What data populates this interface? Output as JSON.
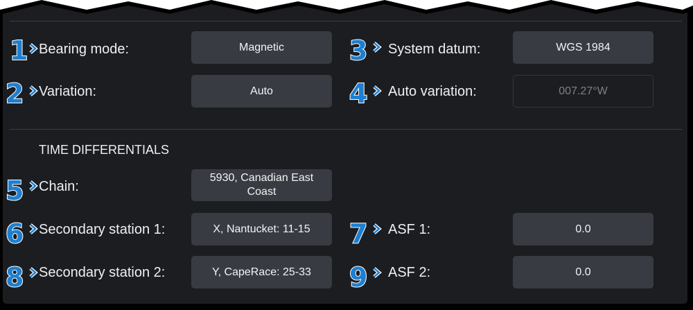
{
  "colors": {
    "panel_bg": "#1c1d20",
    "control_bg": "#383b41",
    "number_blue": "#1e7fd0",
    "text": "#eef0f2",
    "disabled_text": "#7d8186"
  },
  "rows": [
    {
      "marker": "1",
      "label": "Bearing mode:",
      "value": "Magnetic"
    },
    {
      "marker": "2",
      "label": "Variation:",
      "value": "Auto"
    },
    {
      "marker": "3",
      "label": "System datum:",
      "value": "WGS 1984"
    },
    {
      "marker": "4",
      "label": "Auto variation:",
      "value": "007.27°W"
    }
  ],
  "time_differentials": {
    "title": "TIME DIFFERENTIALS",
    "chain": {
      "marker": "5",
      "label": "Chain:",
      "value": "5930, Canadian East Coast"
    },
    "secondary1": {
      "marker": "6",
      "label": "Secondary station 1:",
      "value": "X, Nantucket: 11-15"
    },
    "secondary2": {
      "marker": "8",
      "label": "Secondary station 2:",
      "value": "Y, CapeRace: 25-33"
    },
    "asf1": {
      "marker": "7",
      "label": "ASF 1:",
      "value": "0.0"
    },
    "asf2": {
      "marker": "9",
      "label": "ASF 2:",
      "value": "0.0"
    }
  }
}
